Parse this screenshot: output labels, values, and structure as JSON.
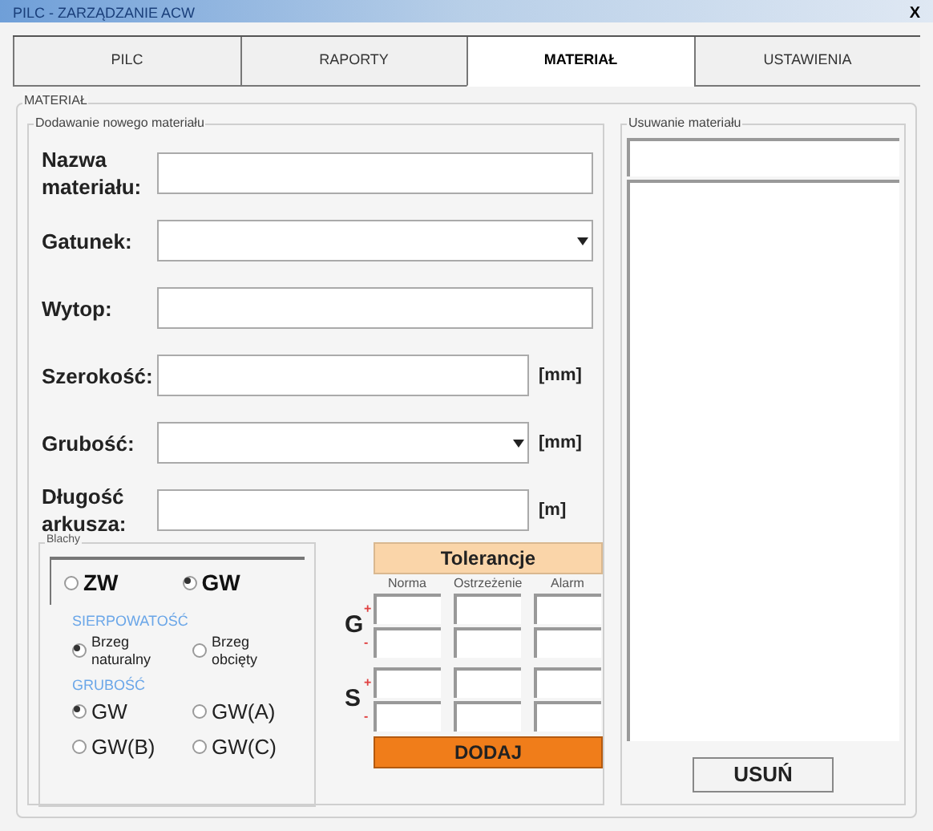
{
  "window": {
    "title": "PILC - ZARZĄDZANIE ACW",
    "close": "X"
  },
  "tabs": [
    {
      "label": "PILC",
      "selected": false
    },
    {
      "label": "RAPORTY",
      "selected": false
    },
    {
      "label": "MATERIAŁ",
      "selected": true
    },
    {
      "label": "USTAWIENIA",
      "selected": false
    }
  ],
  "material_group": {
    "title": "MATERIAŁ"
  },
  "add_group": {
    "title": "Dodawanie nowego materiału",
    "fields": [
      {
        "label": "Nazwa materiału:",
        "kind": "text"
      },
      {
        "label": "Gatunek:",
        "kind": "dropdown"
      },
      {
        "label": "Wytop:",
        "kind": "text"
      },
      {
        "label": "Szerokość:",
        "kind": "text",
        "unit": "[mm]"
      },
      {
        "label": "Grubość:",
        "kind": "dropdown",
        "unit": "[mm]"
      },
      {
        "label": "Długość arkusza:",
        "kind": "text",
        "unit": "[m]"
      }
    ],
    "sheets": {
      "title": "Blachy",
      "type_options": [
        {
          "label": "ZW",
          "selected": false
        },
        {
          "label": "GW",
          "selected": true
        }
      ],
      "sections": [
        {
          "title": "SIERPOWATOŚĆ",
          "options": [
            {
              "label": "Brzeg naturalny",
              "selected": true
            },
            {
              "label": "Brzeg obcięty",
              "selected": false
            }
          ]
        },
        {
          "title": "GRUBOŚĆ",
          "options": [
            {
              "label": "GW",
              "selected": true
            },
            {
              "label": "GW(A)",
              "selected": false
            },
            {
              "label": "GW(B)",
              "selected": false
            },
            {
              "label": "GW(C)",
              "selected": false
            }
          ]
        }
      ]
    },
    "tolerance": {
      "title": "Tolerancje",
      "columns": [
        "Norma",
        "Ostrzeżenie",
        "Alarm"
      ],
      "groups": [
        {
          "label": "G",
          "rows": [
            {
              "sign": "+"
            },
            {
              "sign": "-"
            }
          ]
        },
        {
          "label": "S",
          "rows": [
            {
              "sign": "+"
            },
            {
              "sign": "-"
            }
          ]
        }
      ]
    },
    "add_button": "DODAJ"
  },
  "remove_group": {
    "title": "Usuwanie materiału",
    "button": "USUŃ"
  }
}
